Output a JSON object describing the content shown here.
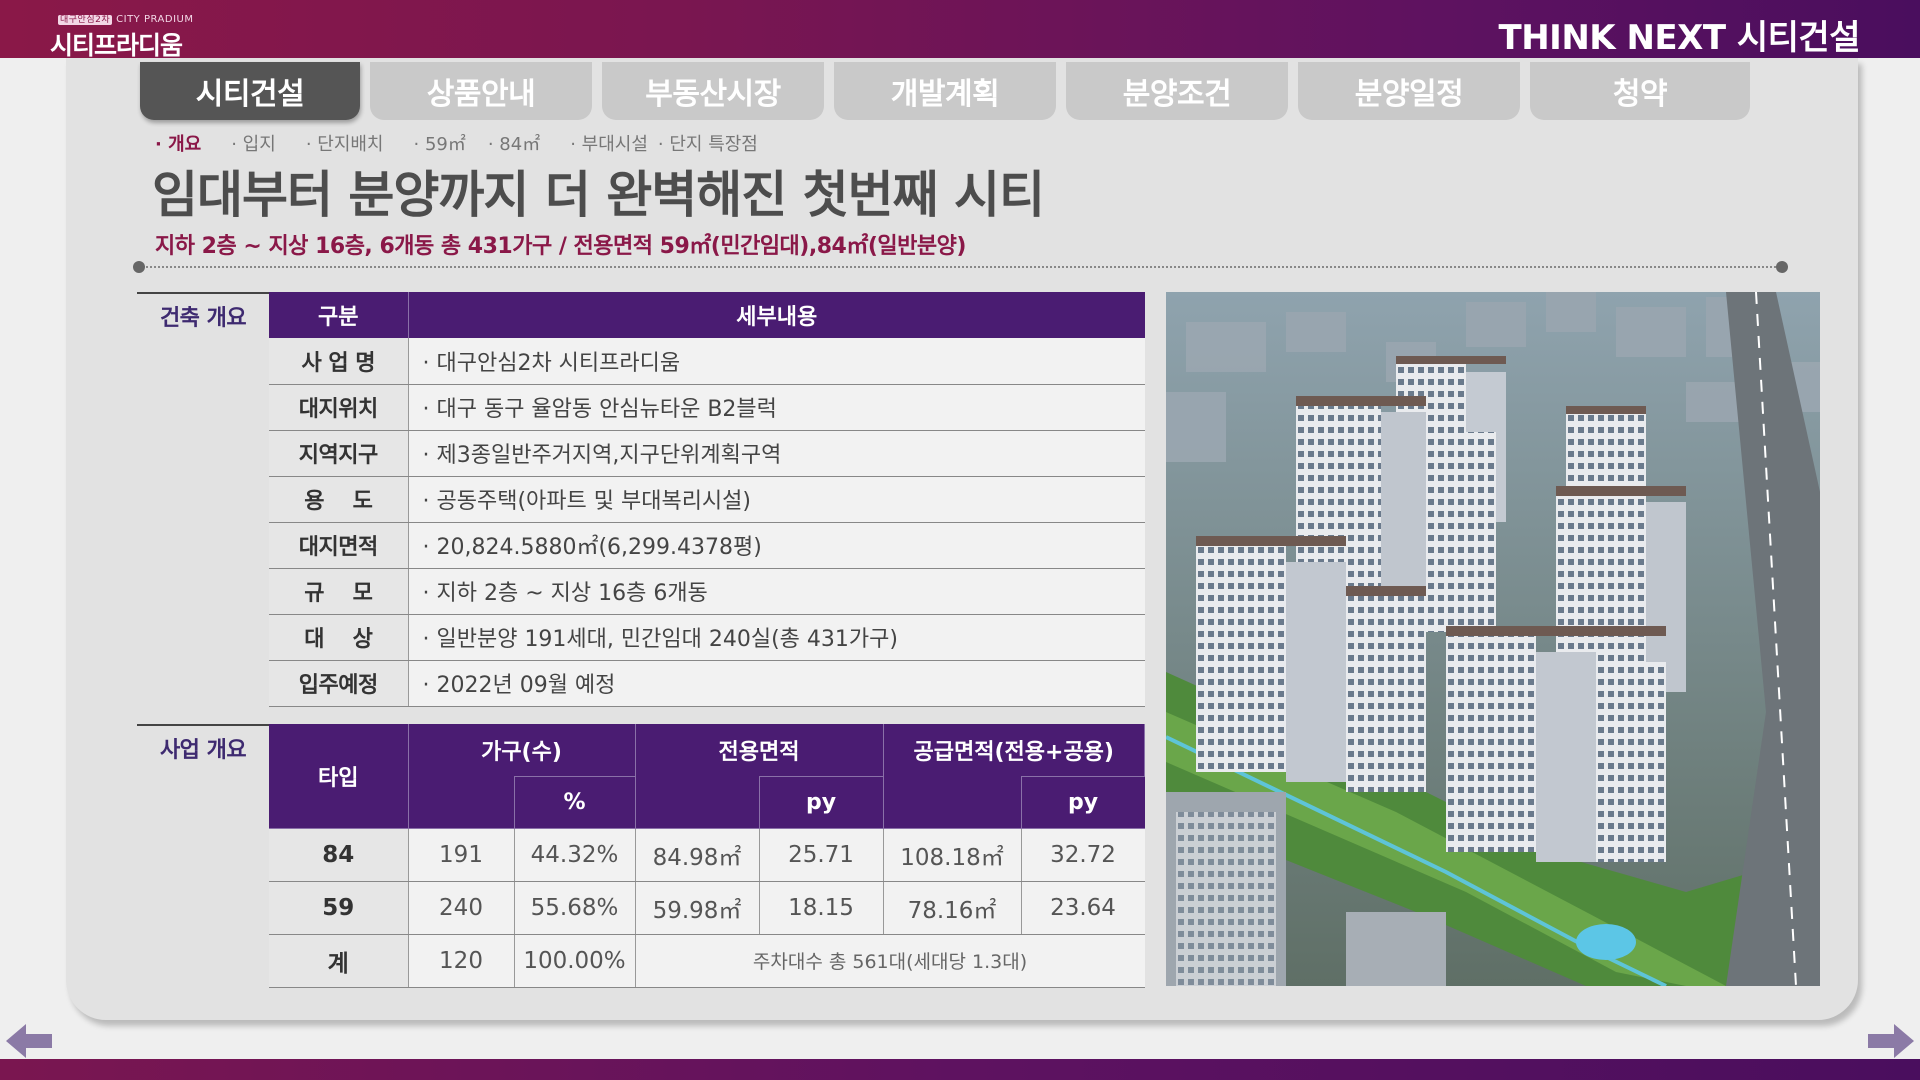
{
  "header": {
    "logo_small": "CITY PRADIUM",
    "logo_tag": "대구안심2차",
    "logo_main": "시티프라디움",
    "brand": "THINK NEXT 시티건설"
  },
  "tabs": [
    {
      "label": "시티건설",
      "active": true
    },
    {
      "label": "상품안내",
      "active": false
    },
    {
      "label": "부동산시장",
      "active": false
    },
    {
      "label": "개발계획",
      "active": false
    },
    {
      "label": "분양조건",
      "active": false
    },
    {
      "label": "분양일정",
      "active": false
    },
    {
      "label": "청약",
      "active": false
    }
  ],
  "subnav": [
    {
      "label": "· 개요",
      "active": true
    },
    {
      "label": "· 입지",
      "active": false
    },
    {
      "label": "· 단지배치",
      "active": false
    },
    {
      "label": "· 59㎡",
      "active": false
    },
    {
      "label": "· 84㎡",
      "active": false
    },
    {
      "label": "· 부대시설",
      "active": false
    },
    {
      "label": "· 단지 특장점",
      "active": false
    }
  ],
  "headline": "임대부터 분양까지 더 완벽해진 첫번째 시티",
  "subline": "지하 2층 ~ 지상 16층, 6개동 총 431가구 / 전용면적 59㎡(민간임대),84㎡(일반분양)",
  "building": {
    "section_label": "건축 개요",
    "col_header_key": "구분",
    "col_header_val": "세부내용",
    "rows": [
      {
        "k": "사 업 명",
        "v": "· 대구안심2차 시티프라디움"
      },
      {
        "k": "대지위치",
        "v": "· 대구 동구 율암동 안심뉴타운 B2블럭"
      },
      {
        "k": "지역지구",
        "v": "· 제3종일반주거지역,지구단위계획구역"
      },
      {
        "k": "용    도",
        "v": "· 공동주택(아파트 및 부대복리시설)"
      },
      {
        "k": "대지면적",
        "v": "· 20,824.5880㎡(6,299.4378평)"
      },
      {
        "k": "규    모",
        "v": "· 지하 2층 ~ 지상 16층  6개동"
      },
      {
        "k": "대    상",
        "v": "· 일반분양 191세대, 민간임대 240실(총 431가구)"
      },
      {
        "k": "입주예정",
        "v": "· 2022년 09월 예정"
      }
    ]
  },
  "business": {
    "section_label": "사업 개요",
    "h_type": "타입",
    "h_units": "가구(수)",
    "h_exclusive": "전용면적",
    "h_supply": "공급면적(전용+공용)",
    "h_pct": "%",
    "h_py1": "py",
    "h_py2": "py",
    "rows": [
      {
        "type": "84",
        "units": "191",
        "pct": "44.32%",
        "excl": "84.98㎡",
        "excl_py": "25.71",
        "supply": "108.18㎡",
        "supply_py": "32.72"
      },
      {
        "type": "59",
        "units": "240",
        "pct": "55.68%",
        "excl": "59.98㎡",
        "excl_py": "18.15",
        "supply": "78.16㎡",
        "supply_py": "23.64"
      }
    ],
    "total": {
      "type": "계",
      "units": "120",
      "pct": "100.00%",
      "note": "주차대수 총 561대(세대당 1.3대)"
    }
  }
}
